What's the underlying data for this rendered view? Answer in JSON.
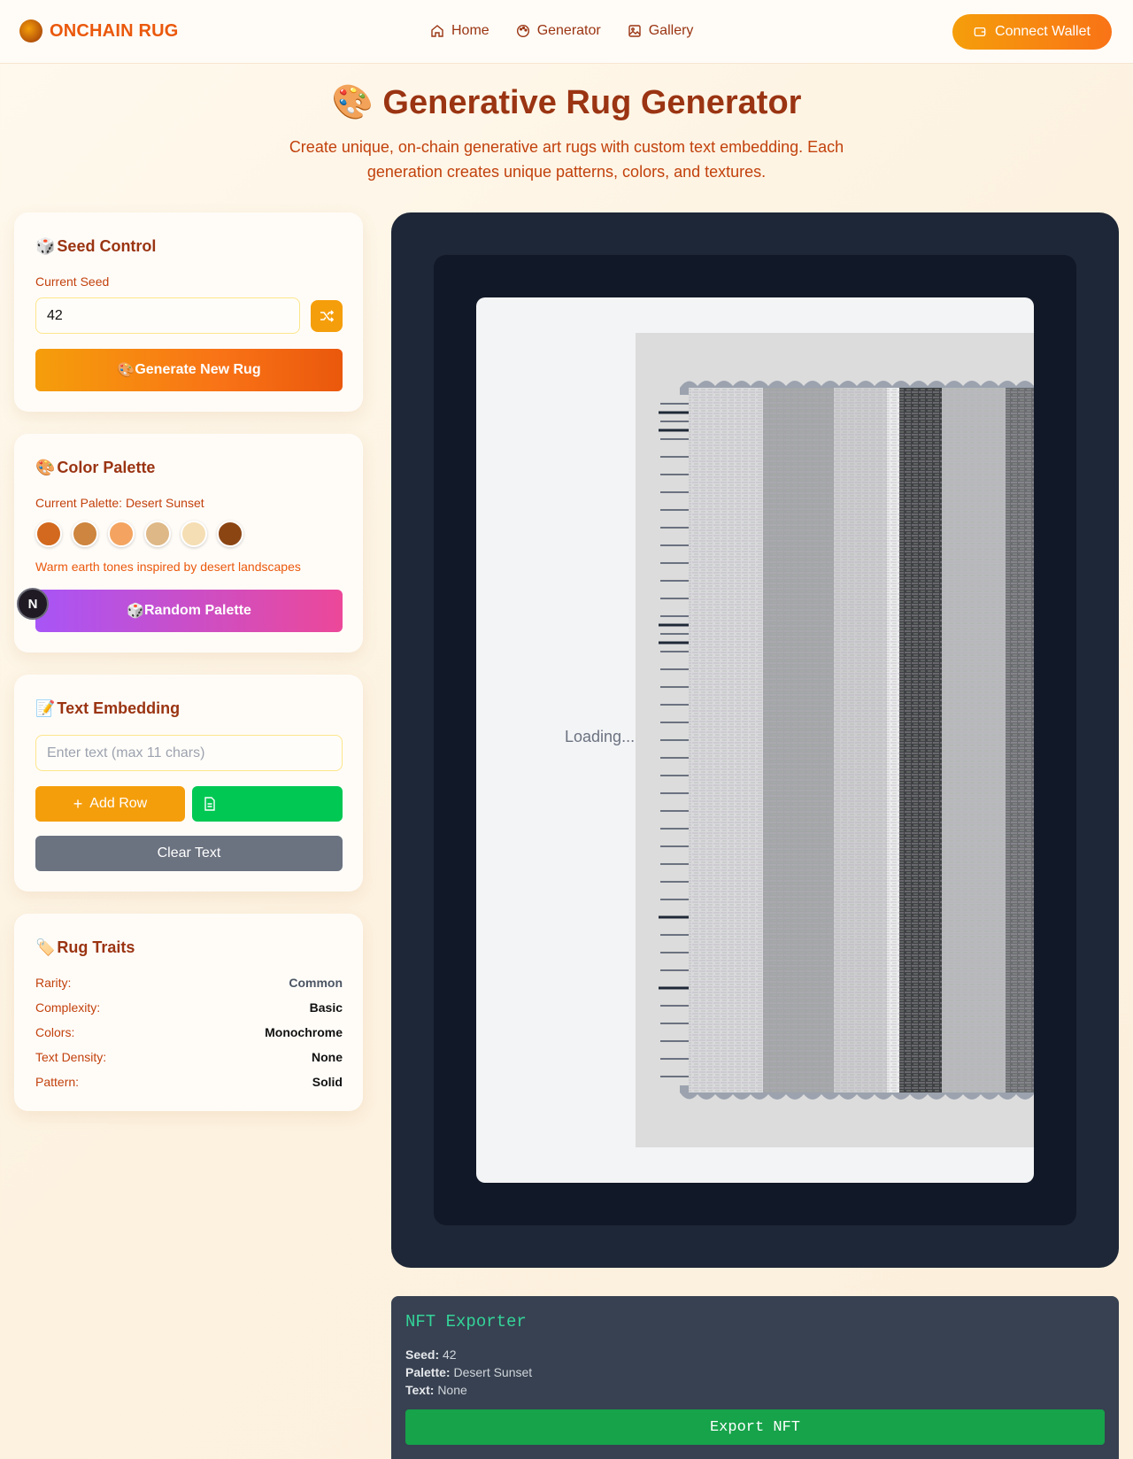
{
  "nav": {
    "brand": "ONCHAIN RUG",
    "links": [
      {
        "label": "Home",
        "icon": "home-icon"
      },
      {
        "label": "Generator",
        "icon": "palette-icon"
      },
      {
        "label": "Gallery",
        "icon": "image-icon"
      }
    ],
    "wallet_label": "Connect Wallet"
  },
  "header": {
    "title": "Generative Rug Generator",
    "subtitle": "Create unique, on-chain generative art rugs with custom text embedding. Each generation creates unique patterns, colors, and textures."
  },
  "seed": {
    "title": "Seed Control",
    "label": "Current Seed",
    "value": "42",
    "generate_label": "Generate New Rug"
  },
  "palette": {
    "title": "Color Palette",
    "current": "Current Palette: Desert Sunset",
    "colors": [
      "#d2691e",
      "#cd853f",
      "#f4a460",
      "#deb887",
      "#f5deb3",
      "#8b4513"
    ],
    "description": "Warm earth tones inspired by desert landscapes",
    "random_label": "Random Palette"
  },
  "text_embed": {
    "title": "Text Embedding",
    "placeholder": "Enter text (max 11 chars)",
    "add_row_label": "Add Row",
    "clear_label": "Clear Text"
  },
  "traits": {
    "title": "Rug Traits",
    "rows": [
      {
        "key": "Rarity:",
        "value": "Common"
      },
      {
        "key": "Complexity:",
        "value": "Basic"
      },
      {
        "key": "Colors:",
        "value": "Monochrome"
      },
      {
        "key": "Text Density:",
        "value": "None"
      },
      {
        "key": "Pattern:",
        "value": "Solid"
      }
    ]
  },
  "canvas": {
    "loading": "Loading..."
  },
  "nft": {
    "title": "NFT Exporter",
    "seed_key": "Seed:",
    "seed_val": "42",
    "palette_key": "Palette:",
    "palette_val": "Desert Sunset",
    "text_key": "Text:",
    "text_val": "None",
    "export_label": "Export NFT"
  }
}
